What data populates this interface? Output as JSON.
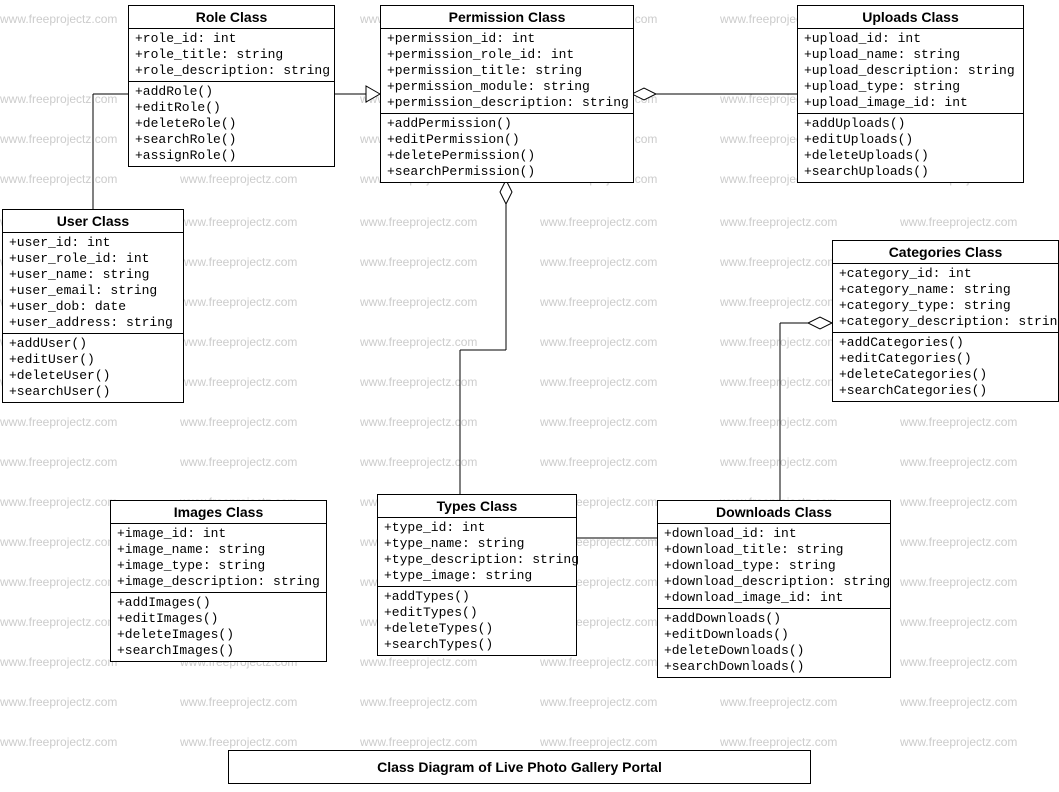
{
  "watermark_text": "www.freeprojectz.com",
  "caption": "Class Diagram of Live Photo Gallery Portal",
  "classes": {
    "role": {
      "title": "Role Class",
      "attrs": [
        "+role_id: int",
        "+role_title: string",
        "+role_description: string"
      ],
      "methods": [
        "+addRole()",
        "+editRole()",
        "+deleteRole()",
        "+searchRole()",
        "+assignRole()"
      ]
    },
    "permission": {
      "title": "Permission Class",
      "attrs": [
        "+permission_id: int",
        "+permission_role_id: int",
        "+permission_title: string",
        "+permission_module: string",
        "+permission_description: string"
      ],
      "methods": [
        "+addPermission()",
        "+editPermission()",
        "+deletePermission()",
        "+searchPermission()"
      ]
    },
    "uploads": {
      "title": "Uploads Class",
      "attrs": [
        "+upload_id: int",
        "+upload_name: string",
        "+upload_description: string",
        "+upload_type: string",
        "+upload_image_id: int"
      ],
      "methods": [
        "+addUploads()",
        "+editUploads()",
        "+deleteUploads()",
        "+searchUploads()"
      ]
    },
    "user": {
      "title": "User Class",
      "attrs": [
        "+user_id: int",
        "+user_role_id: int",
        "+user_name: string",
        "+user_email: string",
        "+user_dob: date",
        "+user_address: string"
      ],
      "methods": [
        "+addUser()",
        "+editUser()",
        "+deleteUser()",
        "+searchUser()"
      ]
    },
    "categories": {
      "title": "Categories Class",
      "attrs": [
        "+category_id: int",
        "+category_name: string",
        "+category_type: string",
        "+category_description: string"
      ],
      "methods": [
        "+addCategories()",
        "+editCategories()",
        "+deleteCategories()",
        "+searchCategories()"
      ]
    },
    "images": {
      "title": "Images Class",
      "attrs": [
        "+image_id: int",
        "+image_name: string",
        "+image_type: string",
        "+image_description: string"
      ],
      "methods": [
        "+addImages()",
        "+editImages()",
        "+deleteImages()",
        "+searchImages()"
      ]
    },
    "types": {
      "title": "Types Class",
      "attrs": [
        "+type_id: int",
        "+type_name: string",
        "+type_description: string",
        "+type_image: string"
      ],
      "methods": [
        "+addTypes()",
        "+editTypes()",
        "+deleteTypes()",
        "+searchTypes()"
      ]
    },
    "downloads": {
      "title": "Downloads Class",
      "attrs": [
        "+download_id: int",
        "+download_title: string",
        "+download_type: string",
        "+download_description: string",
        "+download_image_id: int"
      ],
      "methods": [
        "+addDownloads()",
        "+editDownloads()",
        "+deleteDownloads()",
        "+searchDownloads()"
      ]
    }
  }
}
